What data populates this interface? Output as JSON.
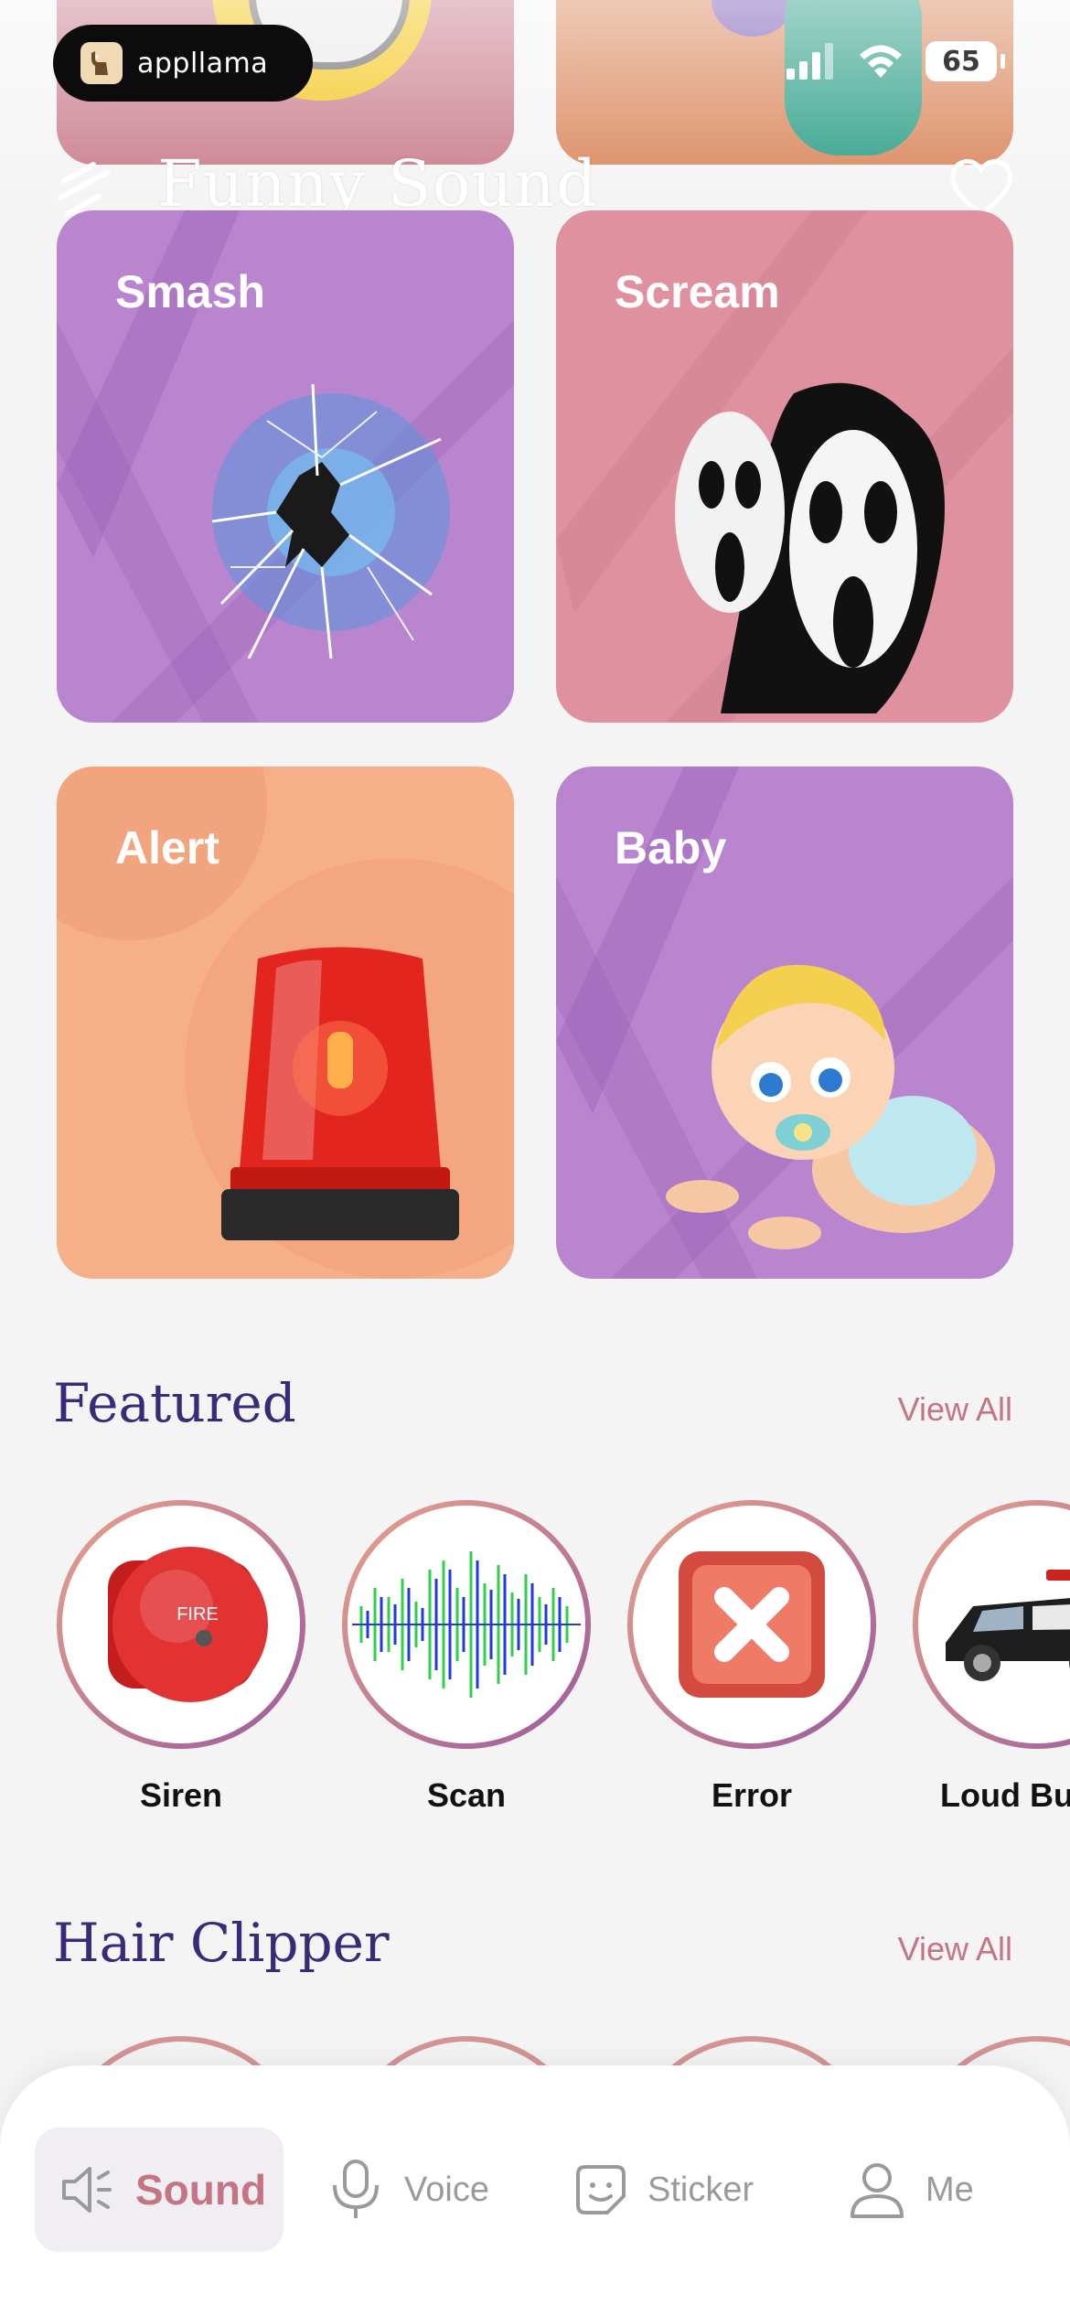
{
  "status_bar": {
    "app_pill_label": "appllama",
    "battery": "65",
    "icons": [
      "signal-icon",
      "wifi-icon",
      "battery-icon"
    ]
  },
  "header": {
    "title": "Funny Sound",
    "menu_icon": "menu-icon",
    "favorite_icon": "heart-icon"
  },
  "categories": [
    {
      "label": "Smash",
      "color": "#b985cf"
    },
    {
      "label": "Scream",
      "color": "#df919f"
    },
    {
      "label": "Alert",
      "color": "#f5b08a"
    },
    {
      "label": "Baby",
      "color": "#b985cf"
    }
  ],
  "featured": {
    "title": "Featured",
    "view_all": "View All",
    "items": [
      {
        "label": "Siren",
        "icon": "fire-bell-icon"
      },
      {
        "label": "Scan",
        "icon": "waveform-icon"
      },
      {
        "label": "Error",
        "icon": "error-x-icon"
      },
      {
        "label": "Loud Bu",
        "icon": "police-car-icon"
      }
    ]
  },
  "hair_clipper": {
    "title": "Hair Clipper",
    "view_all": "View All"
  },
  "bottom_nav": {
    "items": [
      {
        "label": "Sound",
        "icon": "speaker-icon",
        "active": true
      },
      {
        "label": "Voice",
        "icon": "microphone-icon",
        "active": false
      },
      {
        "label": "Sticker",
        "icon": "sticker-face-icon",
        "active": false
      },
      {
        "label": "Me",
        "icon": "user-icon",
        "active": false
      }
    ]
  },
  "colors": {
    "accent": "#c47584",
    "section_title": "#3b2a78",
    "background": "#f4f4f5"
  }
}
